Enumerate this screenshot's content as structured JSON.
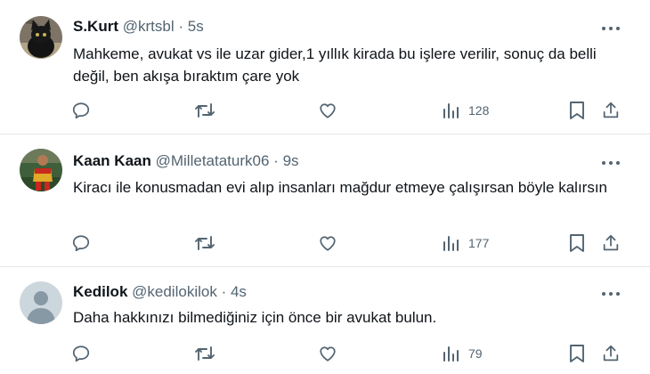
{
  "tweets": [
    {
      "name": "S.Kurt",
      "handle": "@krtsbl",
      "separator": "·",
      "time": "5s",
      "text": "Mahkeme, avukat vs ile uzar gider,1 yıllık kirada bu işlere verilir, sonuç da belli değil, ben akışa bıraktım çare yok",
      "views": "128",
      "avatar_icon": "black-cat-avatar"
    },
    {
      "name": "Kaan Kaan",
      "handle": "@Milletataturk06",
      "separator": "·",
      "time": "9s",
      "text": "Kiracı ile konusmadan evi alıp insanları mağdur etmeye çalışırsan böyle kalırsın",
      "views": "177",
      "avatar_icon": "football-player-avatar"
    },
    {
      "name": "Kedilok",
      "handle": "@kedilokilok",
      "separator": "·",
      "time": "4s",
      "text": "Daha hakkınızı bilmediğiniz için önce bir avukat bulun.",
      "views": "79",
      "avatar_icon": "default-person-avatar"
    }
  ],
  "colors": {
    "text": "#0f1419",
    "secondary": "#536471",
    "divider": "#e1e6ea"
  }
}
